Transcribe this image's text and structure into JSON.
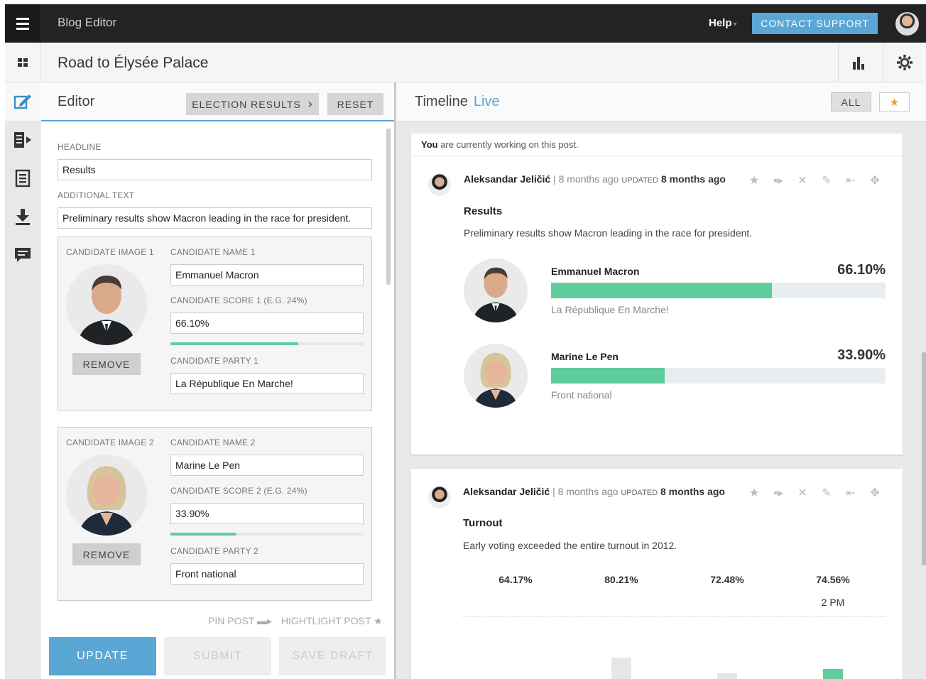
{
  "app": {
    "title": "Blog Editor",
    "help": "Help",
    "contact": "CONTACT SUPPORT"
  },
  "post": {
    "title": "Road to Élysée Palace"
  },
  "editor": {
    "title": "Editor",
    "election_btn": "ELECTION RESULTS",
    "reset_btn": "RESET",
    "headline_label": "HEADLINE",
    "headline": "Results",
    "additional_label": "ADDITIONAL TEXT",
    "additional": "Preliminary results show Macron leading in the race for president.",
    "candidates": [
      {
        "image_label": "CANDIDATE IMAGE 1",
        "name_label": "CANDIDATE NAME 1",
        "name": "Emmanuel Macron",
        "score_label": "CANDIDATE SCORE 1 (E.G. 24%)",
        "score": "66.10%",
        "score_fraction": 0.661,
        "party_label": "CANDIDATE PARTY 1",
        "party": "La République En Marche!",
        "remove": "REMOVE"
      },
      {
        "image_label": "CANDIDATE IMAGE 2",
        "name_label": "CANDIDATE NAME 2",
        "name": "Marine Le Pen",
        "score_label": "CANDIDATE SCORE 2 (E.G. 24%)",
        "score": "33.90%",
        "score_fraction": 0.339,
        "party_label": "CANDIDATE PARTY 2",
        "party": "Front national",
        "remove": "REMOVE"
      }
    ],
    "pin_post": "PIN POST",
    "highlight_post": "HIGHTLIGHT POST",
    "update": "UPDATE",
    "submit": "SUBMIT",
    "save_draft": "SAVE DRAFT"
  },
  "timeline": {
    "title": "Timeline",
    "live": "Live",
    "all_btn": "ALL",
    "notice_you": "You",
    "notice_rest": " are currently working on this post.",
    "posts": [
      {
        "author": "Aleksandar Jeličić",
        "time": " | 8 months ago ",
        "updated_label": "UPDATED",
        "updated_time": " 8 months ago",
        "headline": "Results",
        "text": "Preliminary results show Macron leading in the race for president.",
        "results": [
          {
            "name": "Emmanuel Macron",
            "score": "66.10%",
            "fraction": 0.661,
            "party": "La République En Marche!"
          },
          {
            "name": "Marine Le Pen",
            "score": "33.90%",
            "fraction": 0.339,
            "party": "Front national"
          }
        ]
      },
      {
        "author": "Aleksandar Jeličić",
        "time": " | 8 months ago ",
        "updated_label": "UPDATED",
        "updated_time": " 8 months ago",
        "headline": "Turnout",
        "text": "Early voting exceeded the entire turnout in 2012.",
        "turnout": [
          "64.17%",
          "80.21%",
          "72.48%",
          "74.56%"
        ],
        "turnout_time": "2 PM"
      }
    ]
  },
  "colors": {
    "accent": "#5aa6d4",
    "bar": "#5fcc9c",
    "star": "#f29a12",
    "topbar": "#232323"
  }
}
